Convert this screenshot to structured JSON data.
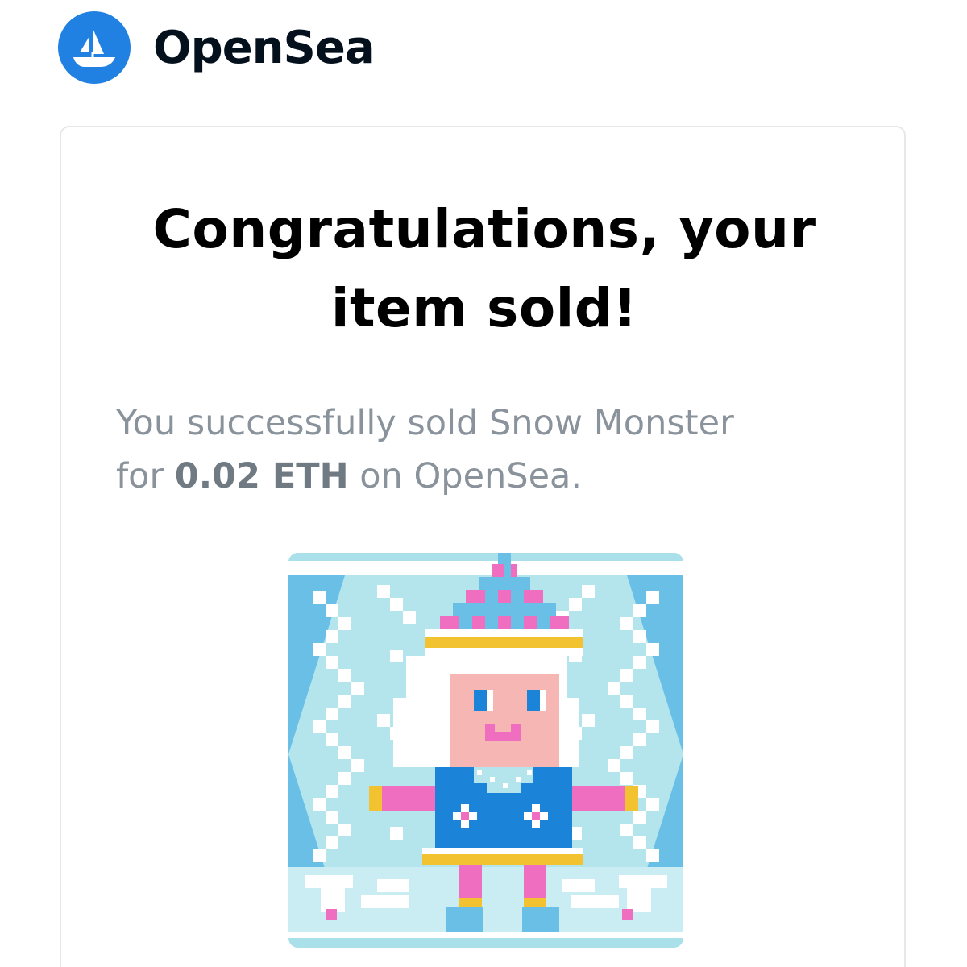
{
  "brand": {
    "name": "OpenSea",
    "logo_color": "#2081e2",
    "logo_icon": "sailboat-icon"
  },
  "card": {
    "headline_line1": "Congratulations, your",
    "headline_line2": "item sold!",
    "message": {
      "prefix": "You successfully sold ",
      "item_name": "Snow Monster",
      "mid": " for ",
      "price": "0.02 ETH",
      "suffix": " on OpenSea."
    },
    "nft_image_icon": "snow-monster-pixel-art"
  },
  "colors": {
    "text_primary": "#000000",
    "text_muted": "#8a939b",
    "card_border": "#e5e8eb"
  }
}
